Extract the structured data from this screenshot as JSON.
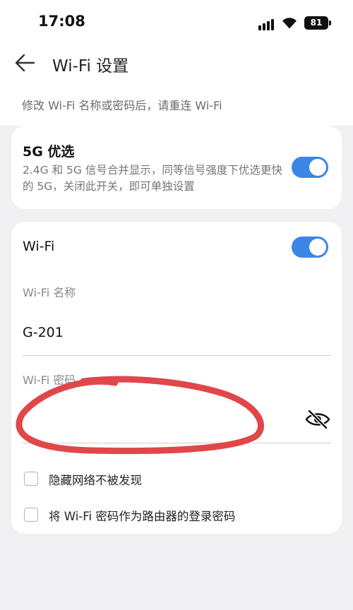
{
  "status_bar": {
    "time": "17:08",
    "battery": "81"
  },
  "header": {
    "title": "Wi-Fi 设置",
    "hint": "修改 Wi-Fi 名称或密码后，请重连 Wi-Fi"
  },
  "band_priority": {
    "title": "5G 优选",
    "description": "2.4G 和 5G 信号合并显示，同等信号强度下优选更快的 5G，关闭此开关，即可单独设置",
    "enabled": true
  },
  "wifi": {
    "label": "Wi-Fi",
    "enabled": true,
    "name_label": "Wi-Fi 名称",
    "name_value": "G-201",
    "password_label": "Wi-Fi 密码",
    "password_value": ""
  },
  "options": [
    {
      "label": "隐藏网络不被发现",
      "checked": false
    },
    {
      "label": "将 Wi-Fi 密码作为路由器的登录密码",
      "checked": false
    }
  ],
  "colors": {
    "accent": "#3c86e6",
    "annotation": "#e0474a"
  }
}
